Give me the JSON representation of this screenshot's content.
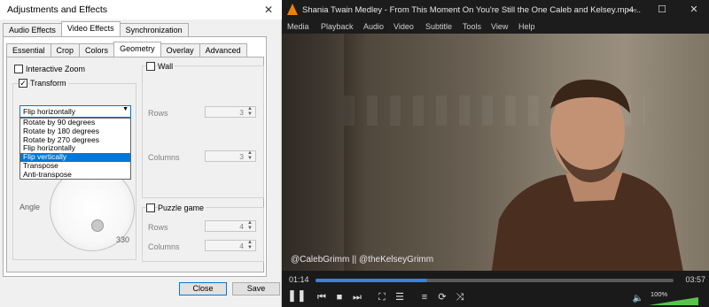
{
  "dialog": {
    "title": "Adjustments and Effects",
    "close_glyph": "✕",
    "tabs": [
      "Audio Effects",
      "Video Effects",
      "Synchronization"
    ],
    "selected_tab": 1,
    "subtabs": [
      "Essential",
      "Crop",
      "Colors",
      "Geometry",
      "Overlay",
      "Advanced"
    ],
    "selected_subtab": 3,
    "geometry": {
      "interactive_zoom": {
        "label": "Interactive Zoom",
        "checked": false
      },
      "transform": {
        "label": "Transform",
        "checked": true
      },
      "transform_select": {
        "value": "Flip horizontally",
        "options": [
          "Rotate by 90 degrees",
          "Rotate by 180 degrees",
          "Rotate by 270 degrees",
          "Flip horizontally",
          "Flip vertically",
          "Transpose",
          "Anti-transpose"
        ],
        "highlighted_index": 4
      },
      "angle_label": "Angle",
      "angle_value": "330",
      "wall": {
        "label": "Wall",
        "checked": false,
        "rows_label": "Rows",
        "rows_value": "3",
        "columns_label": "Columns",
        "columns_value": "3"
      },
      "puzzle": {
        "label": "Puzzle game",
        "checked": false,
        "rows_label": "Rows",
        "rows_value": "4",
        "columns_label": "Columns",
        "columns_value": "4"
      }
    },
    "buttons": {
      "close": "Close",
      "save": "Save"
    }
  },
  "player": {
    "title": "Shania Twain Medley - From This Moment On You're Still the One Caleb and Kelsey.mp4...",
    "window_buttons": {
      "minimize": "—",
      "maximize": "☐",
      "close": "✕"
    },
    "menu": [
      "Media",
      "Playback",
      "Audio",
      "Video",
      "Subtitle",
      "Tools",
      "View",
      "Help"
    ],
    "watermark": "@CalebGrimm || @theKelseyGrimm",
    "time_current": "01:14",
    "time_total": "03:57",
    "progress": 0.312,
    "volume_text": "100%",
    "volume": 1.0,
    "accent_color": "#3b82d6",
    "icons": [
      "pause-icon",
      "previous-icon",
      "stop-icon",
      "next-icon",
      "fullscreen-icon",
      "extended-settings-icon",
      "playlist-icon",
      "loop-icon",
      "shuffle-icon",
      "mute-icon"
    ]
  }
}
